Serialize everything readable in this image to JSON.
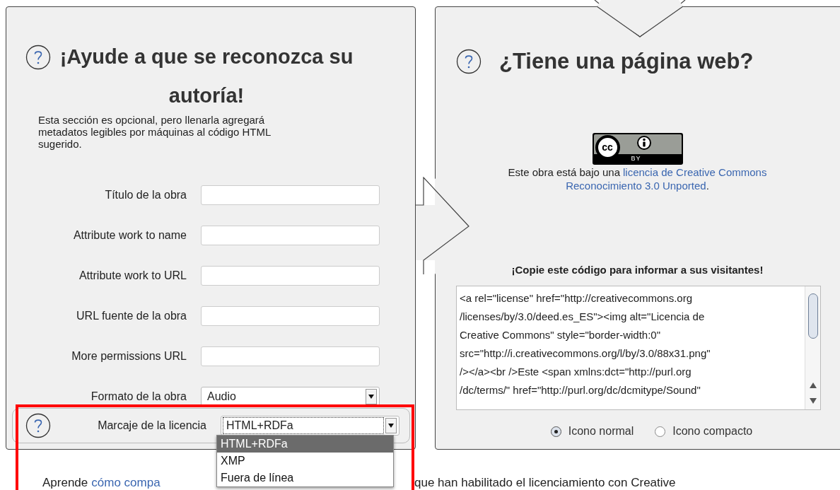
{
  "left_panel": {
    "heading": "¡Ayude a que se reconozca su autoría!",
    "description": "Esta sección es opcional, pero llenarla agregará metadatos legibles por máquinas al código HTML sugerido.",
    "fields": [
      {
        "label": "Título de la obra",
        "kind": "text"
      },
      {
        "label": "Attribute work to name",
        "kind": "text"
      },
      {
        "label": "Attribute work to URL",
        "kind": "text"
      },
      {
        "label": "URL fuente de la obra",
        "kind": "text"
      },
      {
        "label": "More permissions URL",
        "kind": "text"
      },
      {
        "label": "Formato de la obra",
        "kind": "select",
        "value": "Audio"
      }
    ],
    "license_markup": {
      "label": "Marcaje de la licencia",
      "value": "HTML+RDFa",
      "expanded": true,
      "options": [
        {
          "label": "HTML+RDFa",
          "selected": true
        },
        {
          "label": "XMP",
          "selected": false
        },
        {
          "label": "Fuera de línea",
          "selected": false
        }
      ]
    }
  },
  "right_panel": {
    "heading": "¿Tiene una página web?",
    "badge": {
      "logo": "cc",
      "label": "BY"
    },
    "notice": {
      "text": "Este obra está bajo una",
      "link_lines": [
        "licencia de Creative Commons",
        "Reconocimiento 3.0 Unported"
      ],
      "end": "."
    },
    "code_heading": "¡Copie este código para informar a sus visitantes!",
    "code_lines": [
      "<a rel=\"license\" href=\"http://creativecommons.org",
      "/licenses/by/3.0/deed.es_ES\"><img alt=\"Licencia de",
      "Creative Commons\" style=\"border-width:0\"",
      "src=\"http://i.creativecommons.org/l/by/3.0/88x31.png\"",
      "/></a><br />Este <span xmlns:dct=\"http://purl.org",
      "/dc/terms/\" href=\"http://purl.org/dc/dcmitype/Sound\""
    ],
    "icon_options": [
      {
        "label": "Icono normal",
        "selected": true
      },
      {
        "label": "Icono compacto",
        "selected": false
      }
    ]
  },
  "footer": {
    "text": "Aprende",
    "link": "cómo compa",
    "rest": "que han habilitado el licenciamiento con Creative"
  }
}
